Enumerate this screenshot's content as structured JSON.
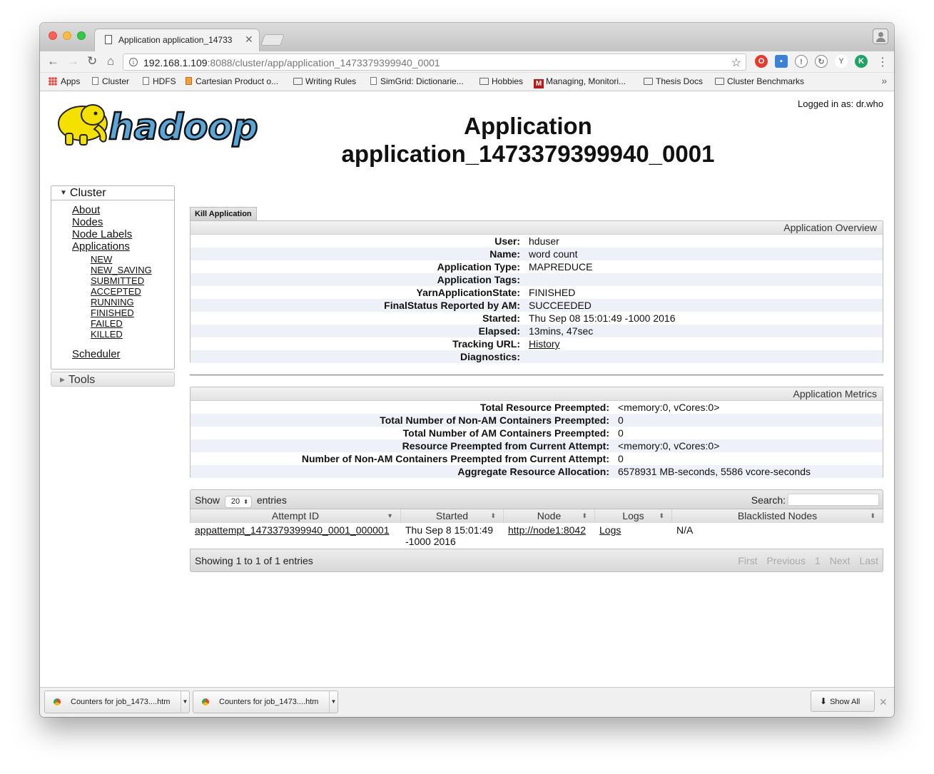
{
  "browser": {
    "tab_title": "Application application_14733",
    "url_host": "192.168.1.109",
    "url_rest": ":8088/cluster/app/application_1473379399940_0001",
    "bookmarks": [
      "Apps",
      "Cluster",
      "HDFS",
      "Cartesian Product o...",
      "Writing Rules",
      "SimGrid: Dictionarie...",
      "Hobbies",
      "Managing, Monitori...",
      "Thesis Docs",
      "Cluster Benchmarks"
    ],
    "more": "»"
  },
  "header": {
    "logo_text": "hadoop",
    "logged_in": "Logged in as: dr.who",
    "title_line1": "Application",
    "title_line2": "application_1473379399940_0001"
  },
  "nav": {
    "cluster_label": "Cluster",
    "links": [
      "About",
      "Nodes",
      "Node Labels",
      "Applications"
    ],
    "states": [
      "NEW",
      "NEW_SAVING",
      "SUBMITTED",
      "ACCEPTED",
      "RUNNING",
      "FINISHED",
      "FAILED",
      "KILLED"
    ],
    "scheduler": "Scheduler",
    "tools_label": "Tools"
  },
  "main": {
    "kill_button": "Kill Application",
    "overview": {
      "heading": "Application Overview",
      "rows": [
        {
          "k": "User:",
          "v": "hduser"
        },
        {
          "k": "Name:",
          "v": "word count"
        },
        {
          "k": "Application Type:",
          "v": "MAPREDUCE"
        },
        {
          "k": "Application Tags:",
          "v": ""
        },
        {
          "k": "YarnApplicationState:",
          "v": "FINISHED"
        },
        {
          "k": "FinalStatus Reported by AM:",
          "v": "SUCCEEDED"
        },
        {
          "k": "Started:",
          "v": "Thu Sep 08 15:01:49 -1000 2016"
        },
        {
          "k": "Elapsed:",
          "v": "13mins, 47sec"
        },
        {
          "k": "Tracking URL:",
          "v": "History"
        },
        {
          "k": "Diagnostics:",
          "v": ""
        }
      ]
    },
    "metrics": {
      "heading": "Application Metrics",
      "rows": [
        {
          "k": "Total Resource Preempted:",
          "v": "<memory:0, vCores:0>"
        },
        {
          "k": "Total Number of Non-AM Containers Preempted:",
          "v": "0"
        },
        {
          "k": "Total Number of AM Containers Preempted:",
          "v": "0"
        },
        {
          "k": "Resource Preempted from Current Attempt:",
          "v": "<memory:0, vCores:0>"
        },
        {
          "k": "Number of Non-AM Containers Preempted from Current Attempt:",
          "v": "0"
        },
        {
          "k": "Aggregate Resource Allocation:",
          "v": "6578931 MB-seconds, 5586 vcore-seconds"
        }
      ]
    },
    "table": {
      "show": "Show",
      "page_size": "20",
      "entries": "entries",
      "search_label": "Search:",
      "search_value": "",
      "columns": [
        "Attempt ID",
        "Started",
        "Node",
        "Logs",
        "Blacklisted Nodes"
      ],
      "rows": [
        {
          "attempt_id": "appattempt_1473379399940_0001_000001",
          "started_1": "Thu Sep 8 15:01:49",
          "started_2": "-1000 2016",
          "node": "http://node1:8042",
          "logs": "Logs",
          "blacklisted": "N/A"
        }
      ],
      "info": "Showing 1 to 1 of 1 entries",
      "pager": [
        "First",
        "Previous",
        "1",
        "Next",
        "Last"
      ]
    }
  },
  "downloads": {
    "items": [
      "Counters for job_1473....htm",
      "Counters for job_1473....htm"
    ],
    "show_all": "Show All"
  },
  "colors": {
    "logo_yellow": "#f5e100",
    "logo_blue": "#5aa6d8",
    "row_alt": "#eef2f8"
  }
}
